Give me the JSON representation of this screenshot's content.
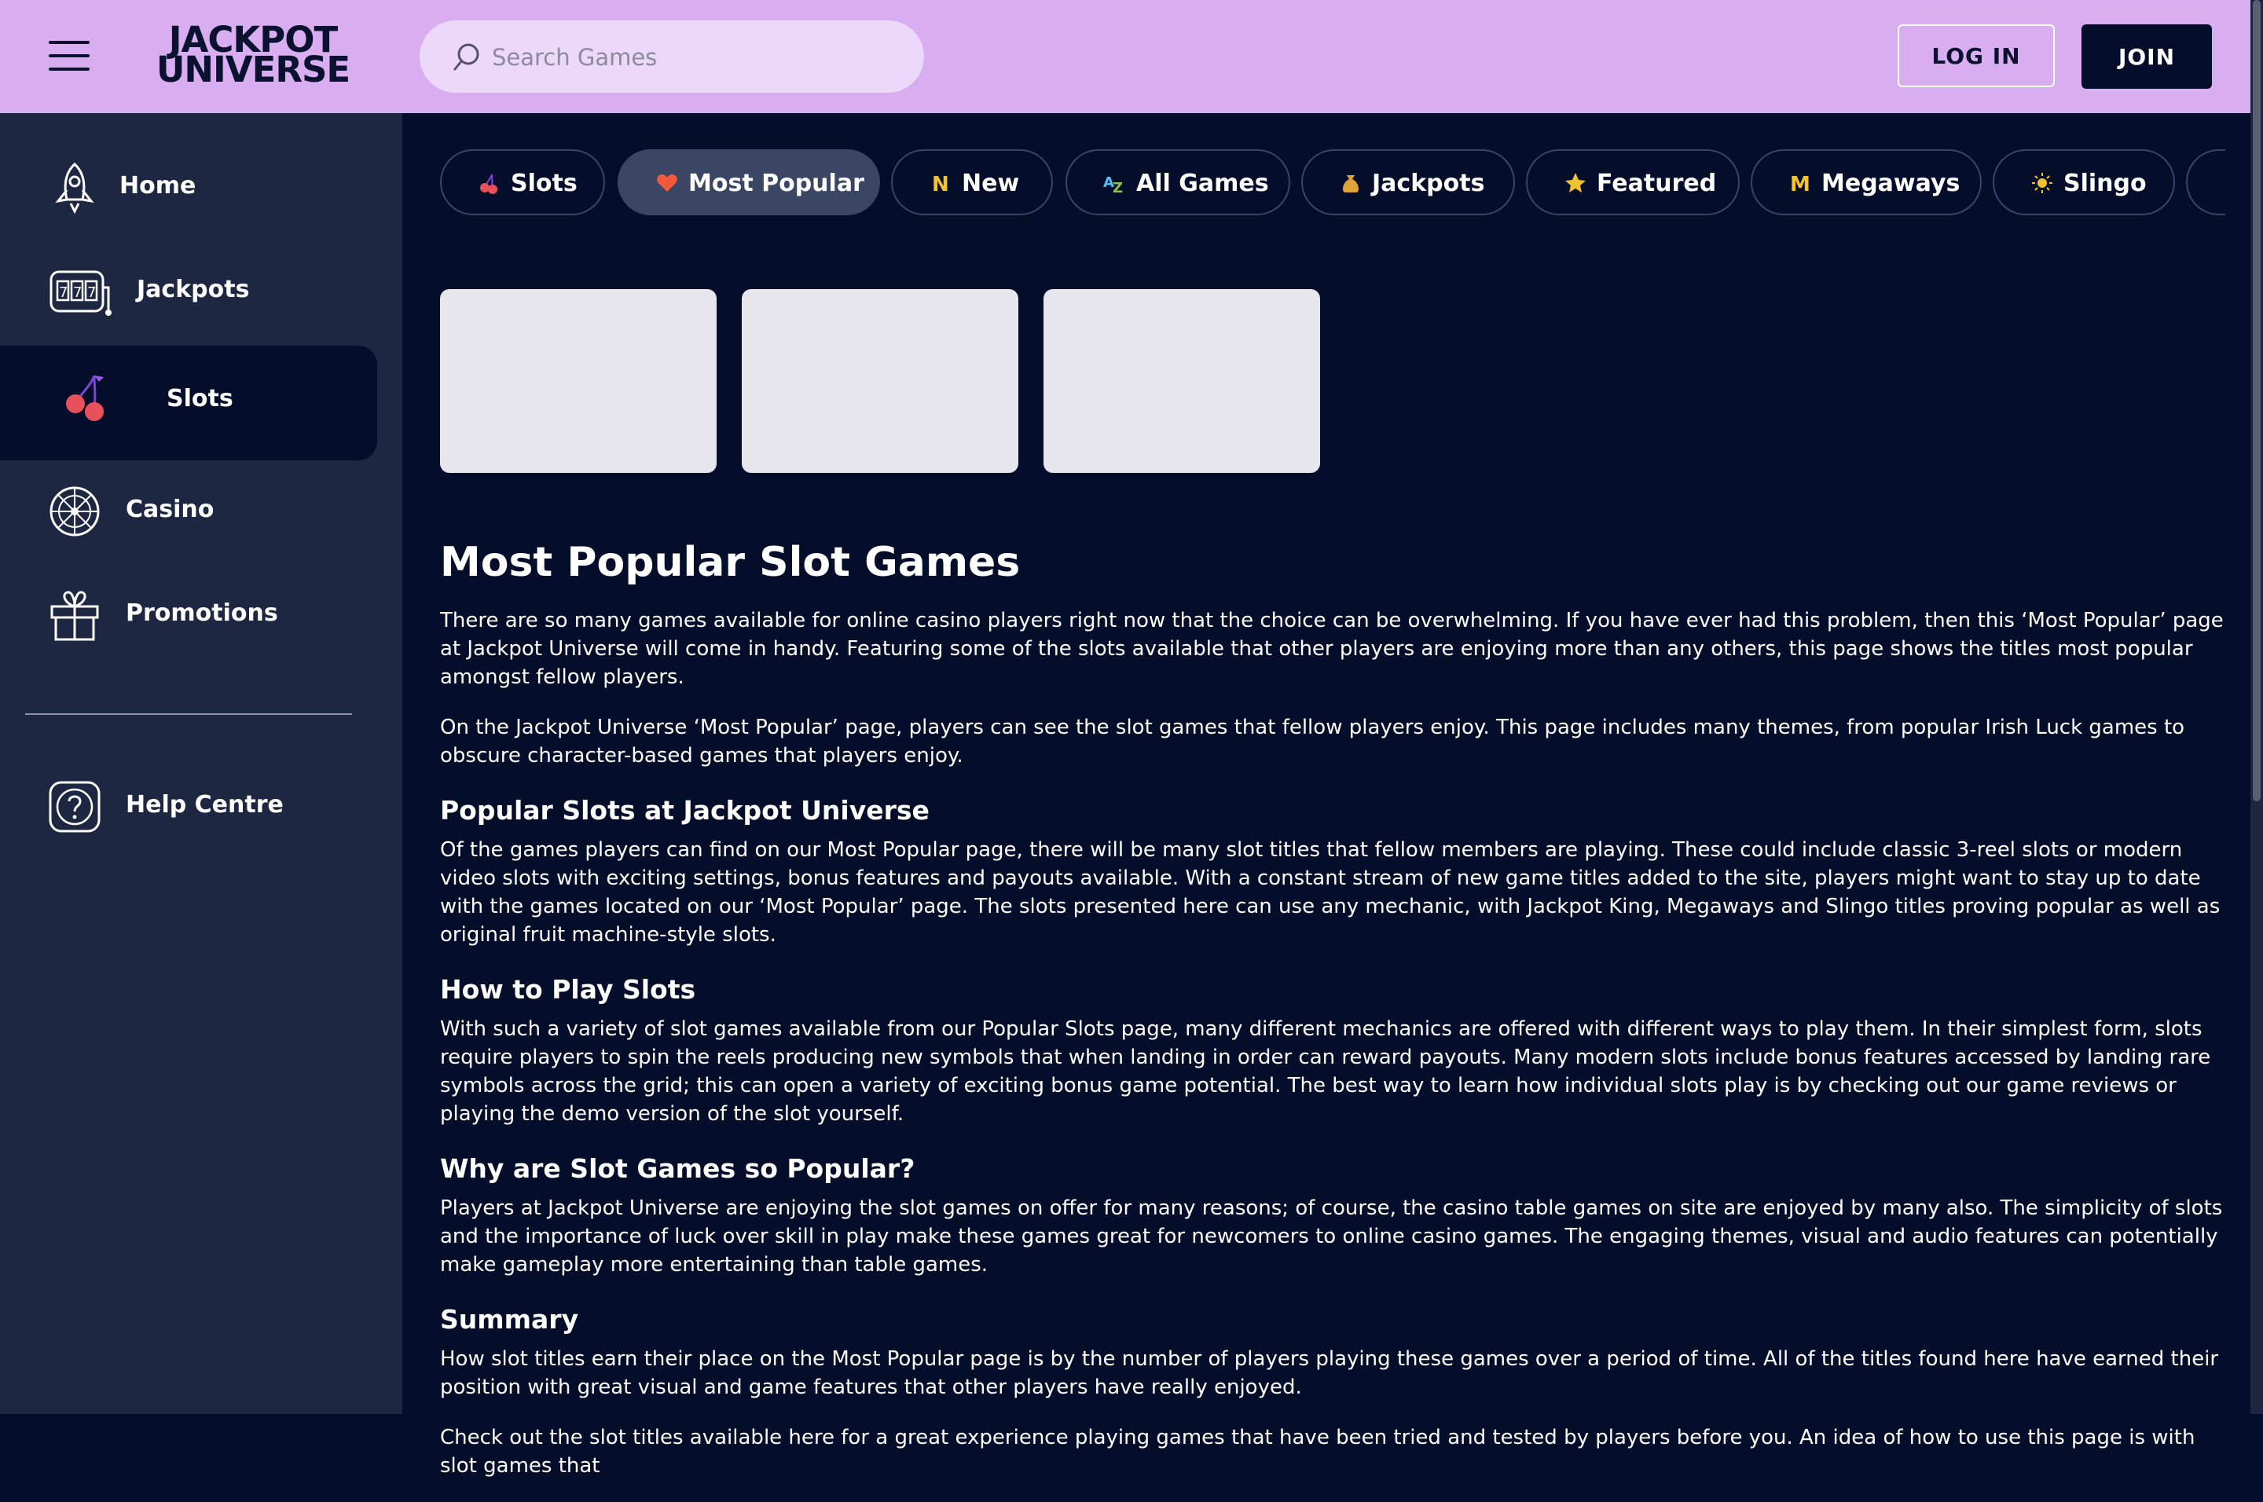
{
  "header": {
    "logo_line1": "JACKPOT",
    "logo_line2": "UNIVERSE",
    "search_placeholder": "Search Games",
    "login_label": "LOG IN",
    "join_label": "JOIN"
  },
  "sidebar": {
    "items": [
      {
        "label": "Home",
        "icon": "rocket-icon"
      },
      {
        "label": "Jackpots",
        "icon": "slot-machine-icon"
      },
      {
        "label": "Slots",
        "icon": "cherries-icon",
        "active": true
      },
      {
        "label": "Casino",
        "icon": "roulette-icon"
      },
      {
        "label": "Promotions",
        "icon": "gift-icon"
      },
      {
        "label": "Help Centre",
        "icon": "help-icon"
      }
    ]
  },
  "tabs": [
    {
      "label": "Slots",
      "icon": "cherries-icon"
    },
    {
      "label": "Most Popular",
      "icon": "heart-icon",
      "active": true
    },
    {
      "label": "New",
      "icon": "new-badge-icon"
    },
    {
      "label": "All Games",
      "icon": "az-icon"
    },
    {
      "label": "Jackpots",
      "icon": "money-bag-icon"
    },
    {
      "label": "Featured",
      "icon": "star-icon"
    },
    {
      "label": "Megaways",
      "icon": "megaways-icon"
    },
    {
      "label": "Slingo",
      "icon": "sun-icon"
    }
  ],
  "colors": {
    "header_bg": "#d9aef0",
    "page_bg": "#040d2a",
    "sidebar_bg": "#1e2742",
    "active_tab_bg": "#3a4663",
    "heart": "#f25a3c",
    "gold": "#f2c230"
  },
  "article": {
    "title": "Most Popular Slot Games",
    "intro1": "There are so many games available for online casino players right now that the choice can be overwhelming. If you have ever had this problem, then this ‘Most Popular’ page at Jackpot Universe will come in handy. Featuring some of the slots available that other players are enjoying more than any others, this page shows the titles most popular amongst fellow players.",
    "intro2": "On the Jackpot Universe ‘Most Popular’ page, players can see the slot games that fellow players enjoy. This page includes many themes, from popular Irish Luck games to obscure character-based games that players enjoy.",
    "sections": [
      {
        "heading": "Popular Slots at Jackpot Universe",
        "body": "Of the games players can find on our Most Popular page, there will be many slot titles that fellow members are playing. These could include classic 3-reel slots or modern video slots with exciting settings, bonus features and payouts available. With a constant stream of new game titles added to the site, players might want to stay up to date with the games located on our ‘Most Popular’ page. The slots presented here can use any mechanic, with Jackpot King, Megaways and Slingo titles proving popular as well as original fruit machine-style slots."
      },
      {
        "heading": "How to Play Slots",
        "body": "With such a variety of slot games available from our Popular Slots page, many different mechanics are offered with different ways to play them. In their simplest form, slots require players to spin the reels producing new symbols that when landing in order can reward payouts. Many modern slots include bonus features accessed by landing rare symbols across the grid; this can open a variety of exciting bonus game potential. The best way to learn how individual slots play is by checking out our game reviews or playing the demo version of the slot yourself."
      },
      {
        "heading": "Why are Slot Games so Popular?",
        "body": "Players at Jackpot Universe are enjoying the slot games on offer for many reasons; of course, the casino table games on site are enjoyed by many also. The simplicity of slots and the importance of luck over skill in play make these games great for newcomers to online casino games. The engaging themes, visual and audio features can potentially make gameplay more entertaining than table games."
      },
      {
        "heading": "Summary",
        "body": "How slot titles earn their place on the Most Popular page is by the number of players playing these games over a period of time. All of the titles found here have earned their position with great visual and game features that other players have really enjoyed."
      }
    ],
    "closing": "Check out the slot titles available here for a great experience playing games that have been tried and tested by players before you. An idea of how to use this page is with slot games that"
  }
}
